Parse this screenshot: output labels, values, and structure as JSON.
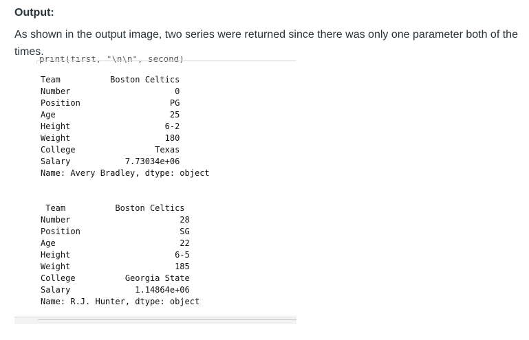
{
  "heading": "Output:",
  "paragraph": "As shown in the output image, two series were returned since there was only one parameter both of the times.",
  "code_fragment": "print(first, \"\\n\\n\", second)",
  "series1": "Team          Boston Celtics\nNumber                     0\nPosition                  PG\nAge                       25\nHeight                   6-2\nWeight                   180\nCollege                Texas\nSalary           7.73034e+06\nName: Avery Bradley, dtype: object",
  "series2": " Team          Boston Celtics\nNumber                      28\nPosition                    SG\nAge                         22\nHeight                     6-5\nWeight                     185\nCollege          Georgia State\nSalary             1.14864e+06\nName: R.J. Hunter, dtype: object"
}
